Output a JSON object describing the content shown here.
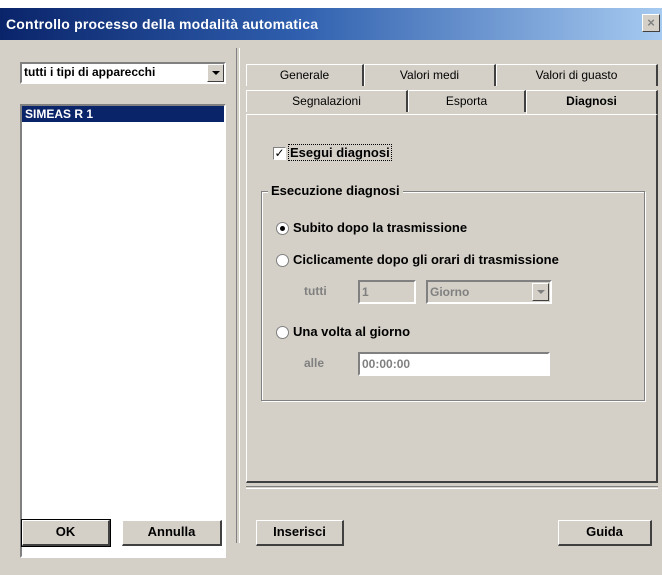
{
  "window": {
    "title": "Controllo processo della modalità automatica",
    "close_glyph": "×"
  },
  "left_panel": {
    "device_type_select": {
      "value": "tutti i tipi di apparecchi"
    },
    "devices": [
      {
        "label": "SIMEAS R 1",
        "selected": true
      }
    ]
  },
  "tabs": {
    "row_back": [
      {
        "label": "Generale"
      },
      {
        "label": "Valori medi"
      },
      {
        "label": "Valori di guasto"
      }
    ],
    "row_front": [
      {
        "label": "Segnalazioni"
      },
      {
        "label": "Esporta"
      },
      {
        "label": "Diagnosi",
        "active": true
      }
    ]
  },
  "diagnosi": {
    "run_checkbox": {
      "label": "Esegui diagnosi",
      "checked": true,
      "check_glyph": "✓"
    },
    "group_title": "Esecuzione diagnosi",
    "options": [
      {
        "label": "Subito dopo la trasmissione",
        "checked": true
      },
      {
        "label": "Ciclicamente dopo gli orari di trasmissione",
        "checked": false
      },
      {
        "label": "Una volta al giorno",
        "checked": false
      }
    ],
    "cyclic": {
      "every_label": "tutti",
      "interval_value": "1",
      "unit_value": "Giorno"
    },
    "daily": {
      "at_label": "alle",
      "time_value": "00:00:00"
    }
  },
  "buttons": {
    "ok": "OK",
    "cancel": "Annulla",
    "insert": "Inserisci",
    "help": "Guida"
  }
}
